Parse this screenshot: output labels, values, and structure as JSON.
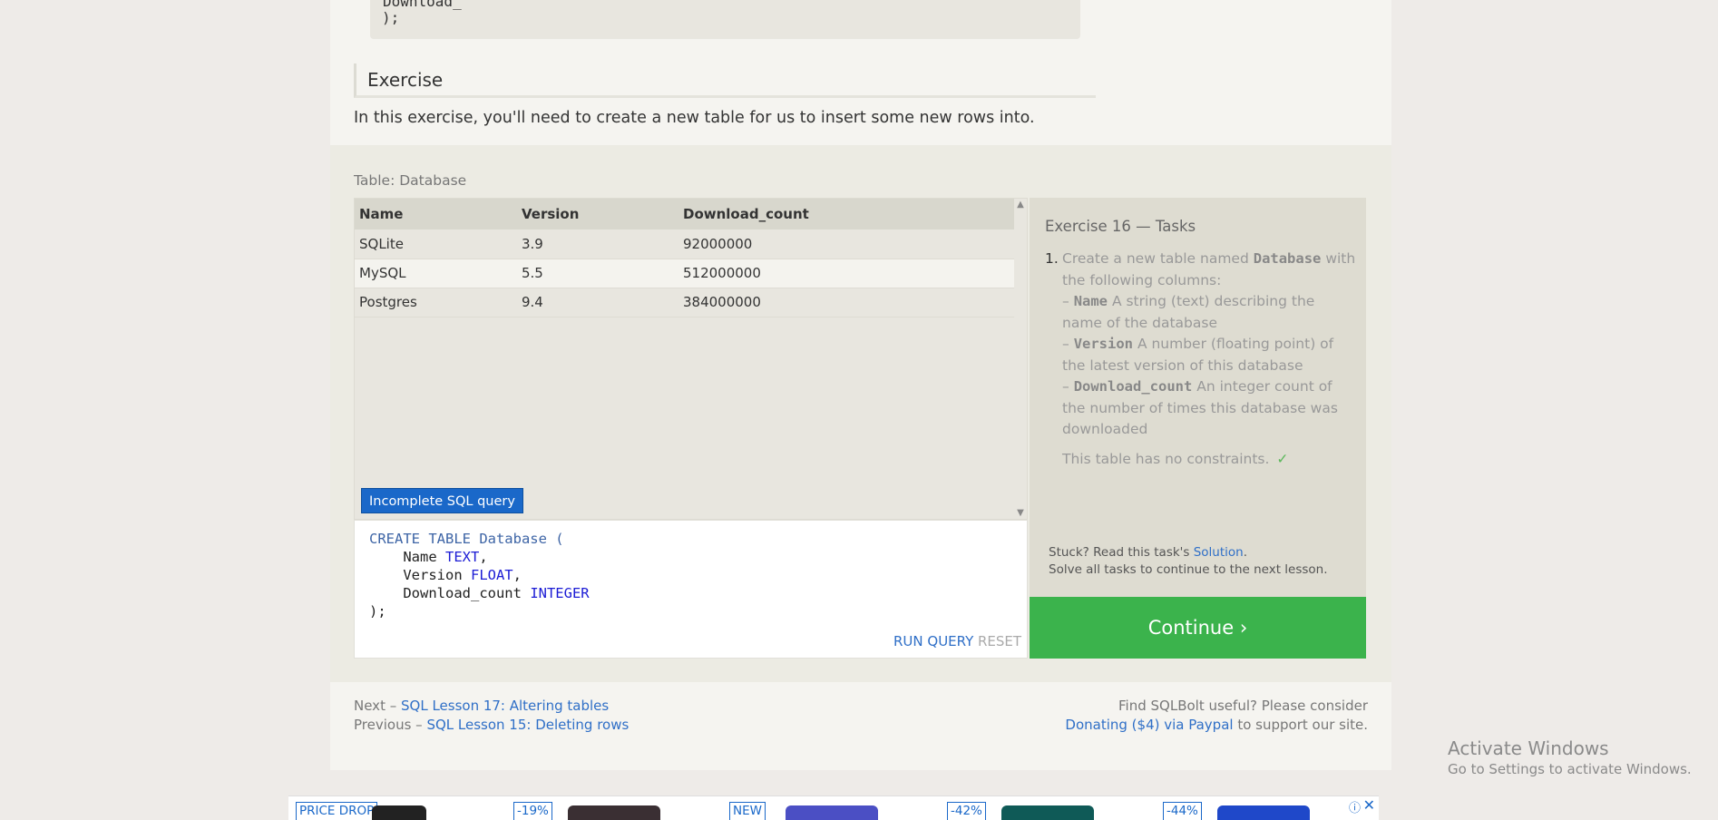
{
  "top_code": {
    "cut_line": "Download_",
    "closing": ");"
  },
  "exercise": {
    "heading": "Exercise",
    "intro": "In this exercise, you'll need to create a new table for us to insert some new rows into."
  },
  "table_label": "Table: Database",
  "results": {
    "headers": [
      "Name",
      "Version",
      "Download_count"
    ],
    "rows": [
      [
        "SQLite",
        "3.9",
        "92000000"
      ],
      [
        "MySQL",
        "5.5",
        "512000000"
      ],
      [
        "Postgres",
        "9.4",
        "384000000"
      ]
    ],
    "scroll_up": "▲",
    "scroll_down": "▼"
  },
  "status_badge": "Incomplete SQL query",
  "editor": {
    "line1_kw": "CREATE TABLE",
    "line1_rest": " Database (",
    "line2_name": "    Name ",
    "line2_type": "TEXT",
    "line3_name": "    Version ",
    "line3_type": "FLOAT",
    "line4_name": "    Download_count ",
    "line4_type": "INTEGER",
    "line5": ");",
    "comma": ",",
    "run_label": "RUN QUERY",
    "reset_label": "RESET"
  },
  "tasks": {
    "title": "Exercise 16 — Tasks",
    "number": "1.",
    "intro_a": "Create a new table named ",
    "table_name": "Database",
    "intro_b": " with the following columns:",
    "dash": "– ",
    "col1_name": "Name",
    "col1_desc": " A string (text) describing the name of the database",
    "col2_name": "Version",
    "col2_desc": " A number (floating point) of the latest version of this database",
    "col3_name": "Download_count",
    "col3_desc": " An integer count of the number of times this database was downloaded",
    "constraint": "This table has no constraints.",
    "check": "✓",
    "stuck_a": "Stuck? Read this task's ",
    "solution_link": "Solution",
    "stuck_b": ".",
    "solve_all": "Solve all tasks to continue to the next lesson."
  },
  "continue_label": "Continue ›",
  "footer": {
    "next_prefix": "Next – ",
    "next_link": "SQL Lesson 17: Altering tables",
    "prev_prefix": "Previous – ",
    "prev_link": "SQL Lesson 15: Deleting rows",
    "useful": "Find SQLBolt useful? Please consider",
    "donate_link": "Donating ($4) via Paypal",
    "donate_suffix": " to support our site."
  },
  "windows_watermark": {
    "title": "Activate Windows",
    "subtitle": "Go to Settings to activate Windows."
  },
  "ad_bar": {
    "tags": [
      "PRICE DROP",
      "-19%",
      "NEW",
      "-42%",
      "-44%"
    ],
    "info": "ⓘ",
    "close": "✕"
  }
}
